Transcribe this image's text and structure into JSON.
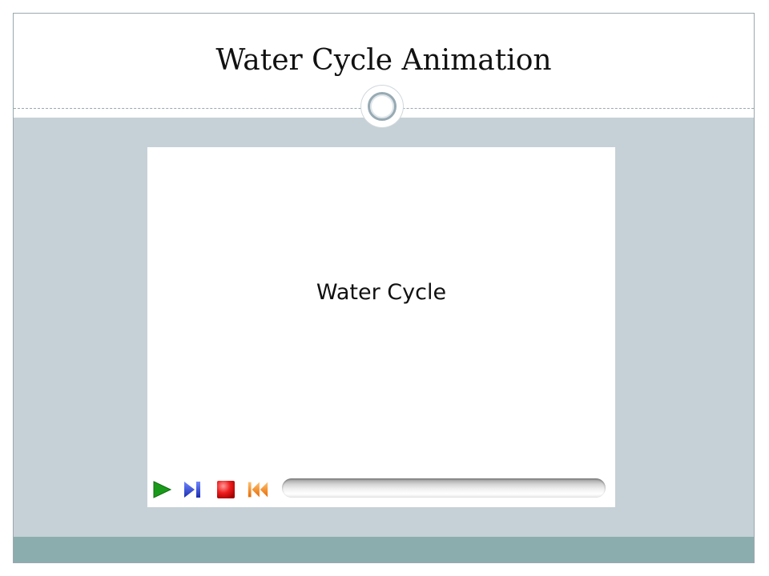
{
  "slide": {
    "title": "Water Cycle Animation"
  },
  "player": {
    "caption": "Water Cycle",
    "progress": 0,
    "controls": [
      {
        "name": "play",
        "icon": "play-icon",
        "color": "#1a9a1a"
      },
      {
        "name": "step-forward",
        "icon": "step-forward-icon",
        "color": "#2a3fd0"
      },
      {
        "name": "stop",
        "icon": "stop-icon",
        "color": "#e01010"
      },
      {
        "name": "rewind",
        "icon": "rewind-to-start-icon",
        "color": "#f07a10"
      }
    ]
  },
  "theme": {
    "content_band": "#c6d1d7",
    "footer_band": "#8cadad",
    "frame_border": "#9aa8ae"
  }
}
